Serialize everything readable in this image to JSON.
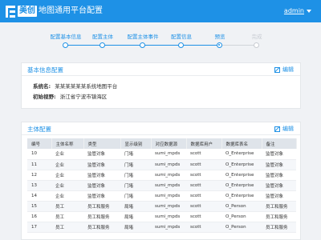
{
  "header": {
    "logo_text": "美创",
    "title": "地图通用平台配置",
    "user": "admin"
  },
  "steps": {
    "items": [
      {
        "label": "配置基本信息",
        "state": "done"
      },
      {
        "label": "配置主体",
        "state": "done"
      },
      {
        "label": "配置主体事件",
        "state": "done"
      },
      {
        "label": "配置信息",
        "state": "done"
      },
      {
        "label": "预览",
        "state": "current"
      },
      {
        "label": "完成",
        "state": "future"
      }
    ]
  },
  "basic_info": {
    "title": "基本信息配置",
    "edit_label": "编辑",
    "system_name_label": "系统名:",
    "system_name_value": "某某某某某某系统地图平台",
    "initial_view_label": "初始视野:",
    "initial_view_value": "浙江省宁波市镇海区"
  },
  "subject_config": {
    "title": "主体配置",
    "edit_label": "编辑",
    "columns": [
      "编号",
      "主体名称",
      "类型",
      "显示级别",
      "对应数据源",
      "数据库用户",
      "数据库表名",
      "备注"
    ],
    "rows": [
      [
        "10",
        "企业",
        "监管对象",
        "门堵",
        "sumi_mpds",
        "scott",
        "O_Enterprise",
        "监管对象"
      ],
      [
        "11",
        "企业",
        "监管对象",
        "门堵",
        "sumi_mpds",
        "scott",
        "O_Enterprise",
        "监管对象"
      ],
      [
        "12",
        "企业",
        "监管对象",
        "门堵",
        "sumi_mpds",
        "scott",
        "O_Enterprise",
        "监管对象"
      ],
      [
        "13",
        "企业",
        "监管对象",
        "门堵",
        "sumi_mpds",
        "scott",
        "O_Enterprise",
        "监管对象"
      ],
      [
        "14",
        "企业",
        "监管对象",
        "门堵",
        "sumi_mpds",
        "scott",
        "O_Enterprise",
        "监管对象"
      ],
      [
        "15",
        "员工",
        "员工和服务",
        "局堵",
        "sumi_mpds",
        "scott",
        "O_Person",
        "员工和服务"
      ],
      [
        "16",
        "员工",
        "员工和服务",
        "局堵",
        "sumi_mpds",
        "scott",
        "O_Person",
        "员工和服务"
      ],
      [
        "17",
        "员工",
        "员工和服务",
        "局堵",
        "sumi_mpds",
        "scott",
        "O_Person",
        "员工和服务"
      ]
    ]
  },
  "colors": {
    "primary": "#1e91e6",
    "background": "#f0f2f5",
    "table_header": "#dfe4ea"
  }
}
